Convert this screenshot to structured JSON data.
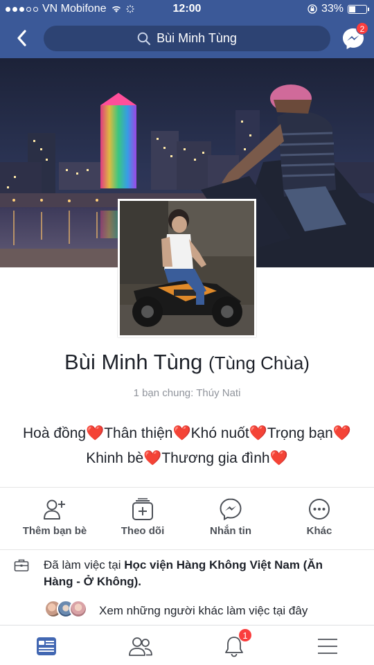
{
  "status_bar": {
    "carrier": "VN Mobifone",
    "time": "12:00",
    "battery": "33%"
  },
  "header": {
    "search_text": "Bùi Minh Tùng",
    "messenger_badge": "2"
  },
  "profile": {
    "name": "Bùi Minh Tùng",
    "nickname": "(Tùng Chùa)",
    "mutual_friends": "1 bạn chung: Thúy Nati",
    "bio_line1": [
      "Hoà đồng",
      "Thân thiện",
      "Khó nuốt",
      "Trọng bạn"
    ],
    "bio_line2": [
      "Khinh bè",
      "Thương gia đình"
    ]
  },
  "actions": {
    "add_friend": "Thêm bạn bè",
    "follow": "Theo dõi",
    "message": "Nhắn tin",
    "more": "Khác"
  },
  "work": {
    "prefix": "Đã làm việc tại ",
    "place": "Học viện Hàng Không Việt Nam (Ăn Hàng - Ở Không).",
    "coworkers_text": "Xem những người khác làm việc tại đây"
  },
  "tabbar": {
    "notifications_badge": "1"
  },
  "colors": {
    "brand_blue": "#3b5998",
    "badge_red": "#fa3e3e",
    "active_tab": "#4267b2"
  }
}
